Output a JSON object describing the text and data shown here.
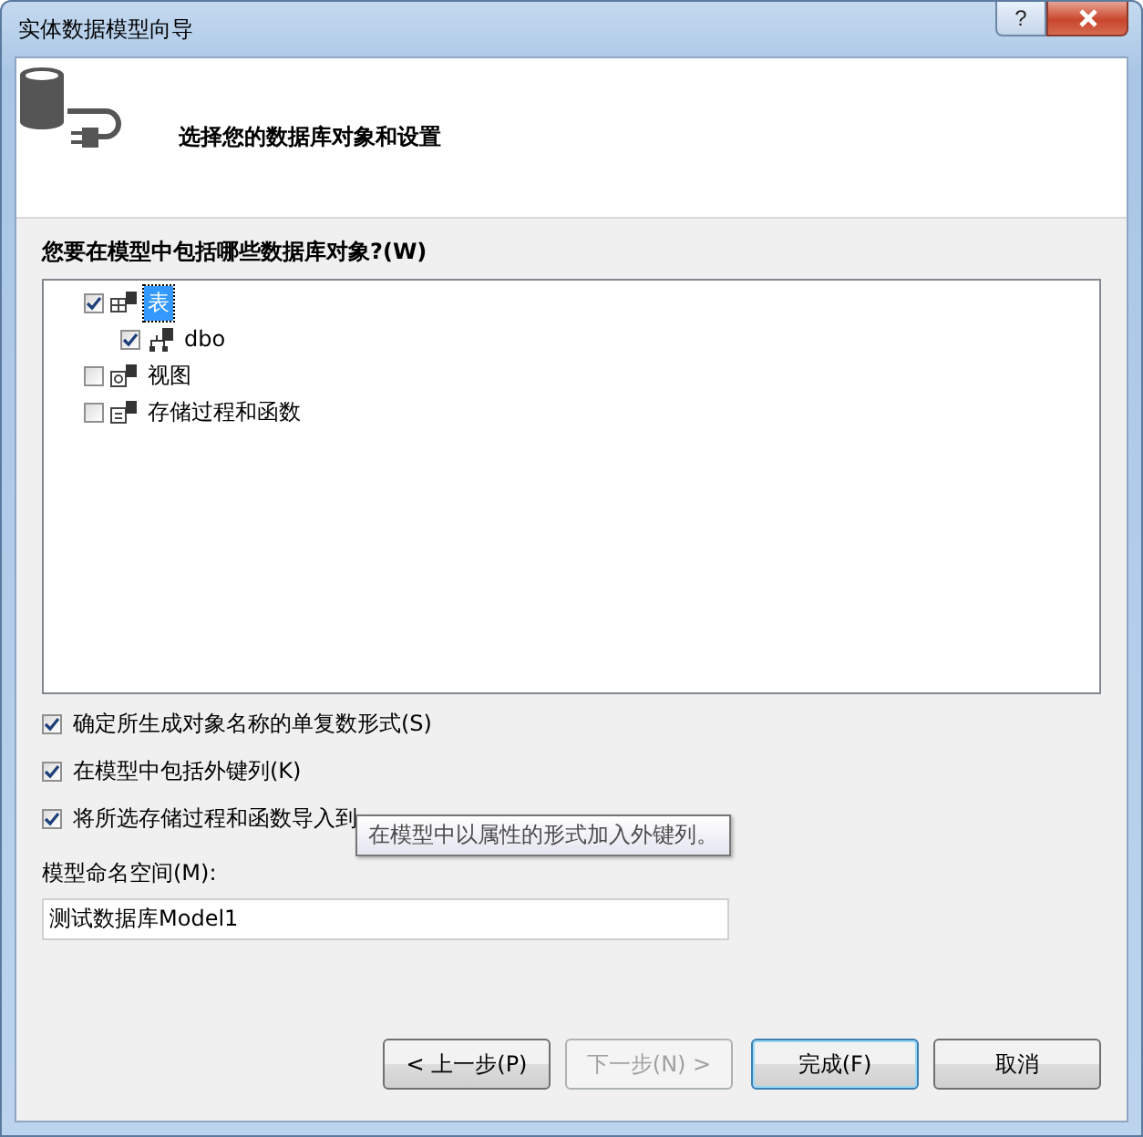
{
  "window": {
    "title": "实体数据模型向导",
    "help_button": "?"
  },
  "header": {
    "title": "选择您的数据库对象和设置"
  },
  "objects_label": "您要在模型中包括哪些数据库对象?(W)",
  "tree": [
    {
      "label": "表",
      "checked": true,
      "selected": true,
      "kind": "table",
      "children": [
        {
          "label": "dbo",
          "checked": true,
          "selected": false,
          "kind": "schema"
        }
      ]
    },
    {
      "label": "视图",
      "checked": false,
      "selected": false,
      "kind": "view"
    },
    {
      "label": "存储过程和函数",
      "checked": false,
      "selected": false,
      "kind": "procedure"
    }
  ],
  "options": [
    {
      "label": "确定所生成对象名称的单复数形式(S)",
      "checked": true
    },
    {
      "label": "在模型中包括外键列(K)",
      "checked": true
    },
    {
      "label": "将所选存储过程和函数导入到",
      "checked": true
    }
  ],
  "tooltip": "在模型中以属性的形式加入外键列。",
  "namespace": {
    "label": "模型命名空间(M):",
    "value": "测试数据库Model1"
  },
  "buttons": [
    {
      "label": "< 上一步(P)",
      "disabled": false,
      "default": false
    },
    {
      "label": "下一步(N) >",
      "disabled": true,
      "default": false
    },
    {
      "label": "完成(F)",
      "disabled": false,
      "default": true
    },
    {
      "label": "取消",
      "disabled": false,
      "default": false
    }
  ]
}
